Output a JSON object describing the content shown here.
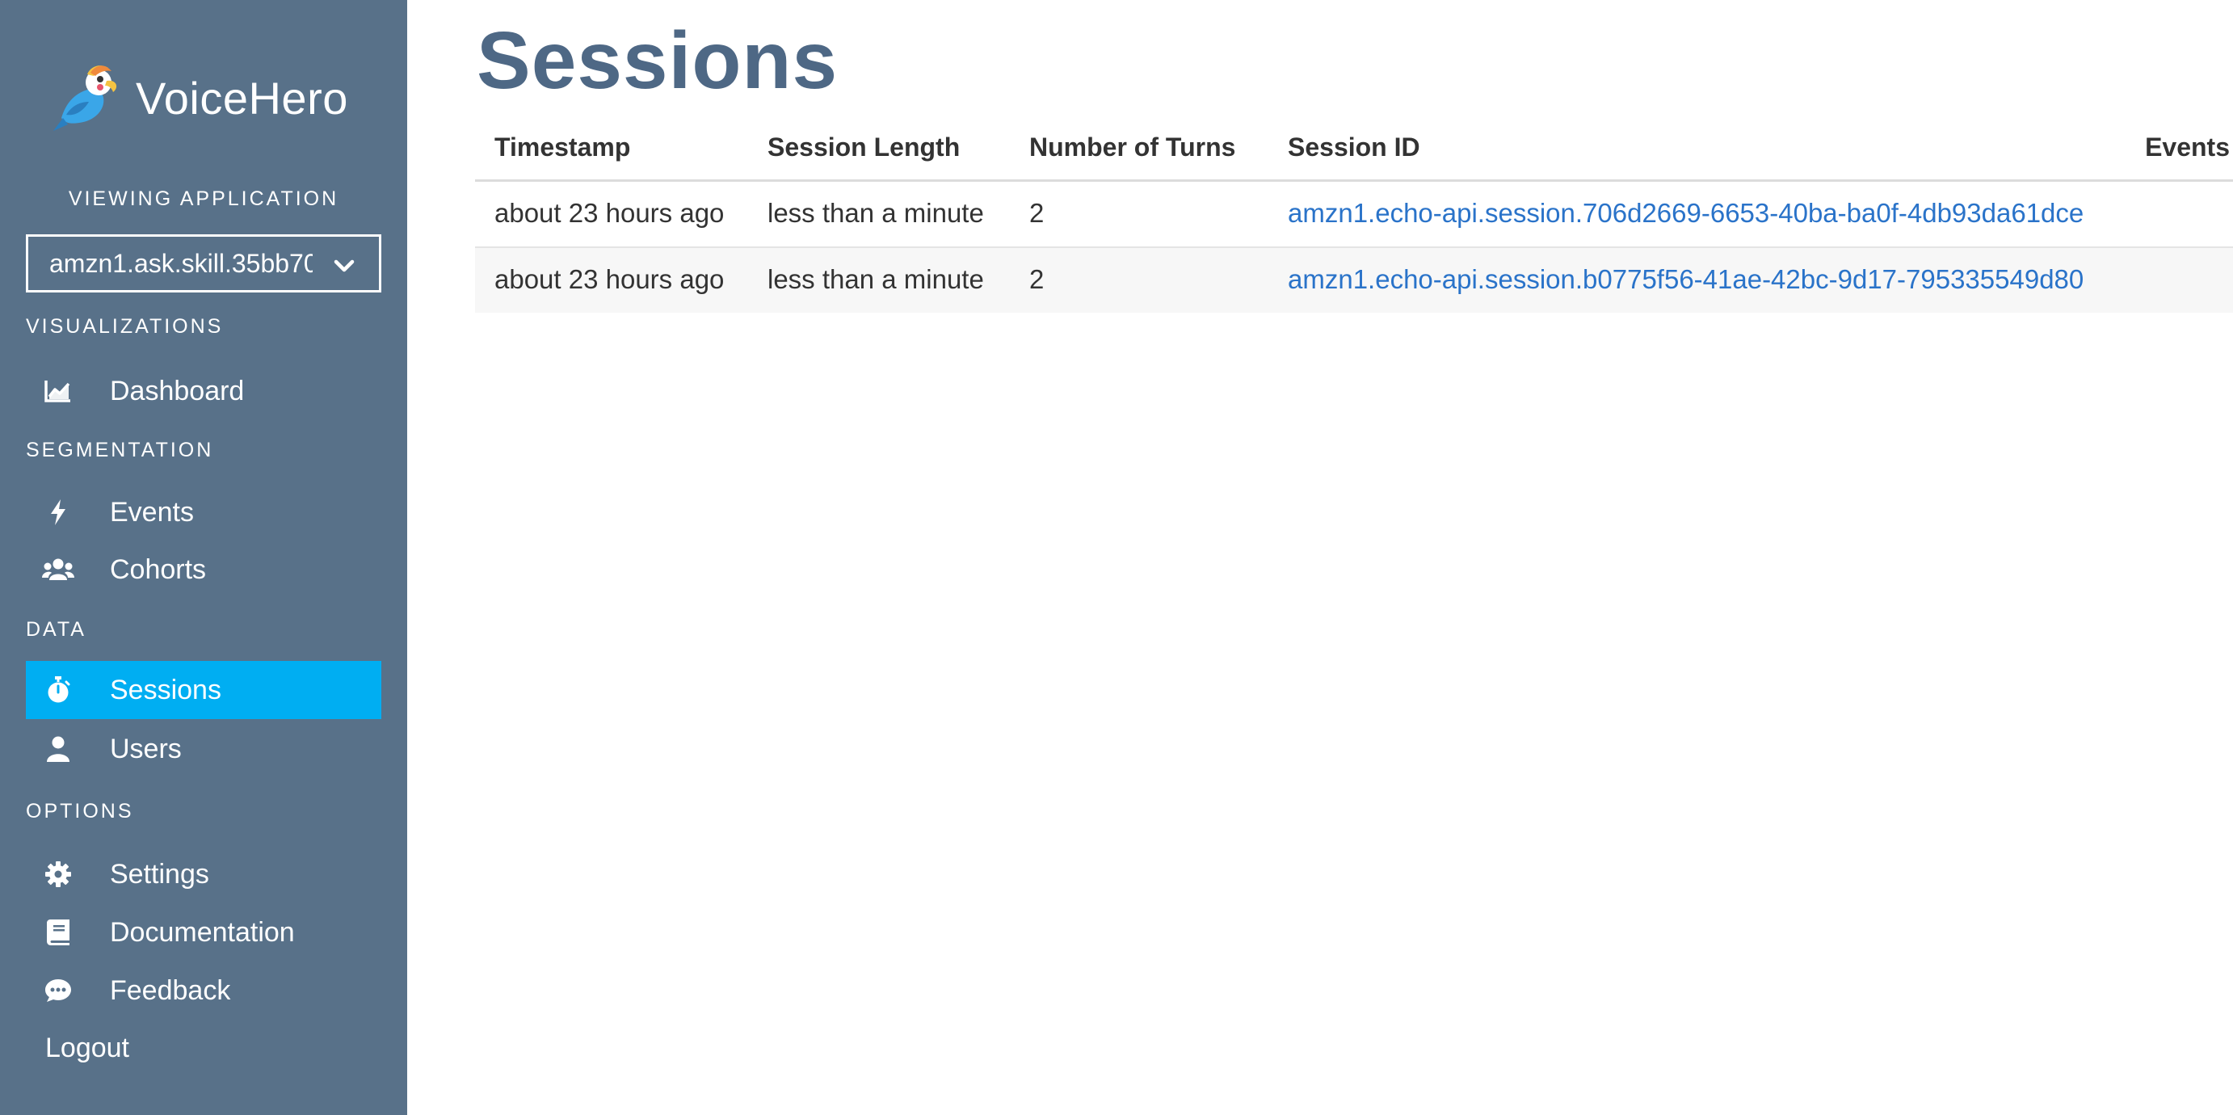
{
  "brand": {
    "name": "VoiceHero",
    "logo_icon": "parrot-logo-icon"
  },
  "sidebar": {
    "viewing_label": "VIEWING APPLICATION",
    "app_select_value": "amzn1.ask.skill.35bb70",
    "sections": {
      "visualizations": "VISUALIZATIONS",
      "segmentation": "SEGMENTATION",
      "data": "DATA",
      "options": "OPTIONS"
    },
    "items": [
      {
        "label": "Dashboard",
        "icon": "line-chart-icon"
      },
      {
        "label": "Events",
        "icon": "bolt-icon"
      },
      {
        "label": "Cohorts",
        "icon": "users-icon"
      },
      {
        "label": "Sessions",
        "icon": "stopwatch-icon",
        "active": true
      },
      {
        "label": "Users",
        "icon": "user-icon"
      },
      {
        "label": "Settings",
        "icon": "gear-icon"
      },
      {
        "label": "Documentation",
        "icon": "book-icon"
      },
      {
        "label": "Feedback",
        "icon": "chat-bubble-icon"
      }
    ],
    "logout_label": "Logout",
    "active_color": "#00aef2",
    "background_color": "#587189"
  },
  "main": {
    "title": "Sessions",
    "table": {
      "headers": [
        "Timestamp",
        "Session Length",
        "Number of Turns",
        "Session ID",
        "Events"
      ],
      "rows": [
        {
          "timestamp": "about 23 hours ago",
          "length": "less than a minute",
          "turns": "2",
          "session_id": "amzn1.echo-api.session.706d2669-6653-40ba-ba0f-4db93da61dce",
          "events": ""
        },
        {
          "timestamp": "about 23 hours ago",
          "length": "less than a minute",
          "turns": "2",
          "session_id": "amzn1.echo-api.session.b0775f56-41ae-42bc-9d17-795335549d80",
          "events": ""
        }
      ]
    },
    "link_color": "#2a73c9",
    "title_color": "#4e6885"
  }
}
